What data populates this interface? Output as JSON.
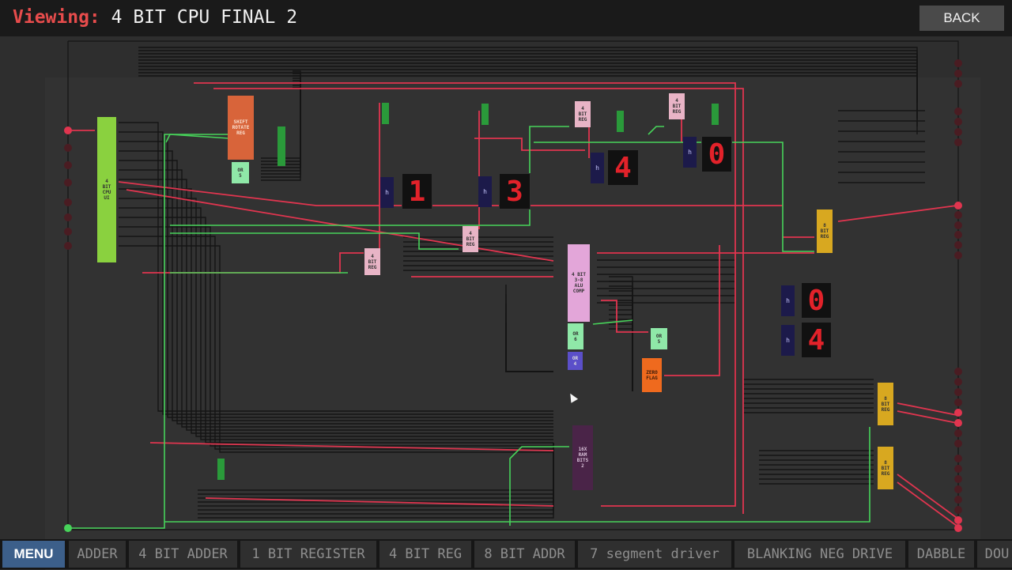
{
  "header": {
    "viewing_label": "Viewing:",
    "circuit_name": "4 BIT CPU FINAL 2",
    "back_label": "BACK"
  },
  "tabs": [
    "MENU",
    "ADDER",
    "4 BIT ADDER",
    "1 BIT REGISTER",
    "4 BIT REG",
    "8 BIT ADDR",
    "7 segment driver",
    "BLANKING NEG DRIVE",
    "DABBLE",
    "DOU"
  ],
  "chips": {
    "cpu_main": "4\nBIT\nCPU\nUI",
    "shift_rotate": "SHIFT\nROTATE\nREG",
    "or5_top": "OR\n5",
    "alu": "4 BIT\n3-8\nALU\nCOMP",
    "or6": "OR\n6",
    "or4": "OR\n4",
    "or5_right": "OR\n5",
    "zero_flag": "ZERO\nFLAG",
    "ram": "16X\nRAM\nBITS\n2",
    "reg_a": "4\nBIT\nREG",
    "reg_b": "4\nBIT\nREG",
    "reg_c": "4\nBIT\nREG",
    "reg_d": "4\nBIT\nREG",
    "reg_out": "8\nBIT\nREG",
    "reg_right1": "8\nBIT\nREG",
    "reg_right2": "8\nBIT\nREG",
    "hex_label": "h"
  },
  "displays": {
    "seg1": "1",
    "seg2": "3",
    "seg3": "4",
    "seg4": "0",
    "seg5": "0",
    "seg6": "4"
  },
  "colors": {
    "wire_off": "#141414",
    "wire_red": "#e0354f",
    "wire_green": "#47d35a",
    "cpu_chip": "#8ad13f",
    "shift_chip": "#d8643a",
    "alu_chip": "#e3a6d9",
    "reg_chip": "#e8b4c6",
    "gold_chip": "#d8a820",
    "or_chip": "#8fe8a8",
    "zero_chip": "#ef6a1e",
    "ram_chip": "#4a2448"
  }
}
